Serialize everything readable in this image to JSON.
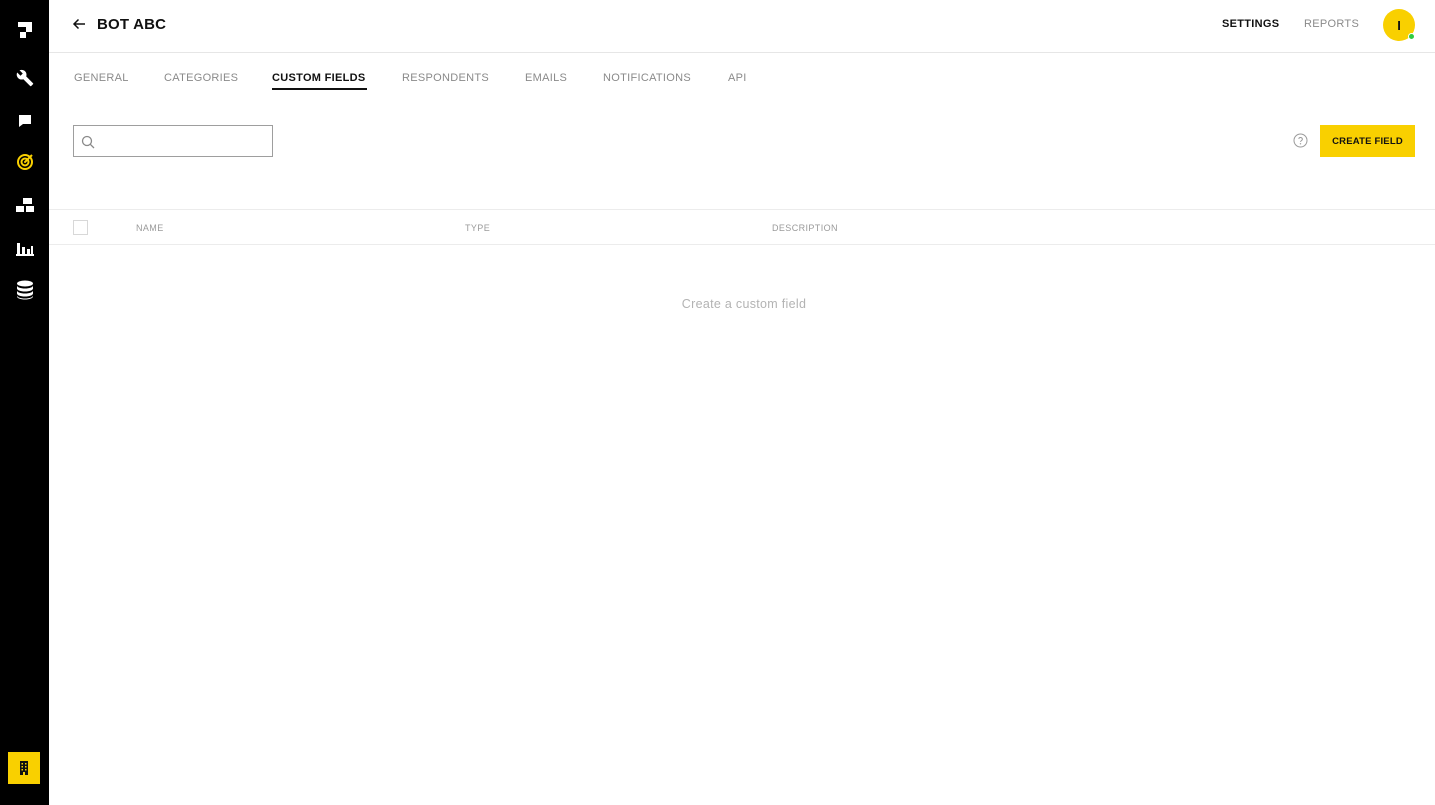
{
  "app": {
    "title": "BOT ABC"
  },
  "sidebar": {
    "items": [
      {
        "icon": "logo-icon"
      },
      {
        "icon": "wrench-icon"
      },
      {
        "icon": "chat-icon"
      },
      {
        "icon": "target-icon",
        "active": true
      },
      {
        "icon": "flow-icon"
      },
      {
        "icon": "bar-chart-icon"
      },
      {
        "icon": "database-icon"
      }
    ],
    "bottom_icon": "building-icon"
  },
  "header": {
    "settings_label": "SETTINGS",
    "reports_label": "REPORTS",
    "avatar_initial": "I"
  },
  "tabs": [
    {
      "label": "GENERAL"
    },
    {
      "label": "CATEGORIES"
    },
    {
      "label": "CUSTOM FIELDS",
      "active": true
    },
    {
      "label": "RESPONDENTS"
    },
    {
      "label": "EMAILS"
    },
    {
      "label": "NOTIFICATIONS"
    },
    {
      "label": "API"
    }
  ],
  "toolbar": {
    "search_value": "",
    "create_label": "CREATE FIELD"
  },
  "table": {
    "columns": [
      "NAME",
      "TYPE",
      "DESCRIPTION"
    ],
    "rows": [],
    "empty_message": "Create a custom field"
  },
  "colors": {
    "accent": "#f9d000",
    "sidebar_bg": "#000000",
    "status_online": "#2ecc40"
  }
}
